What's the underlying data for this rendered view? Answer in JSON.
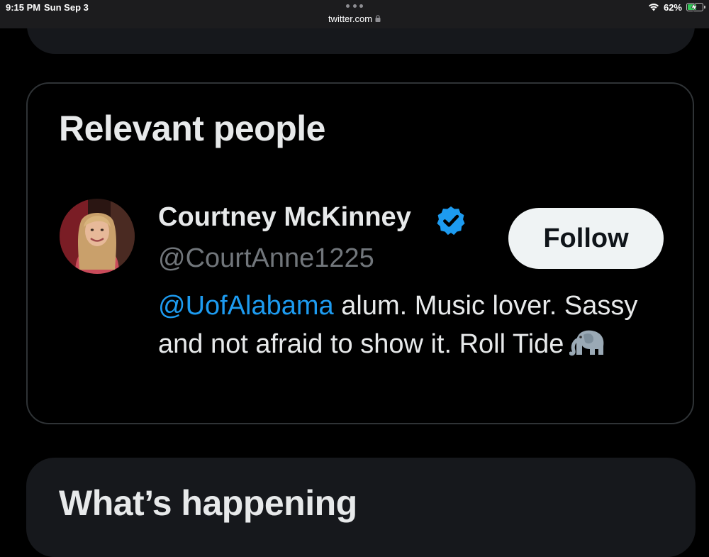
{
  "status_bar": {
    "time": "9:15 PM",
    "date": "Sun Sep 3",
    "url": "twitter.com",
    "battery_percent": "62%",
    "battery_level": 0.62,
    "battery_color": "#34c759"
  },
  "relevant_people": {
    "title": "Relevant people",
    "person": {
      "name": "Courtney McKinney",
      "handle": "@CourtAnne1225",
      "verified": true,
      "follow_label": "Follow",
      "bio_mention": "@UofAlabama",
      "bio_text": " alum. Music lover. Sassy and not afraid to show it. Roll Tide",
      "bio_emoji": "elephant-icon"
    }
  },
  "whats_happening": {
    "title": "What’s happening"
  },
  "colors": {
    "background": "#000000",
    "card": "#16181c",
    "border": "#2f3336",
    "text_primary": "#e7e9ea",
    "text_secondary": "#71767b",
    "link": "#1d9bf0",
    "button_bg": "#eff3f4"
  }
}
